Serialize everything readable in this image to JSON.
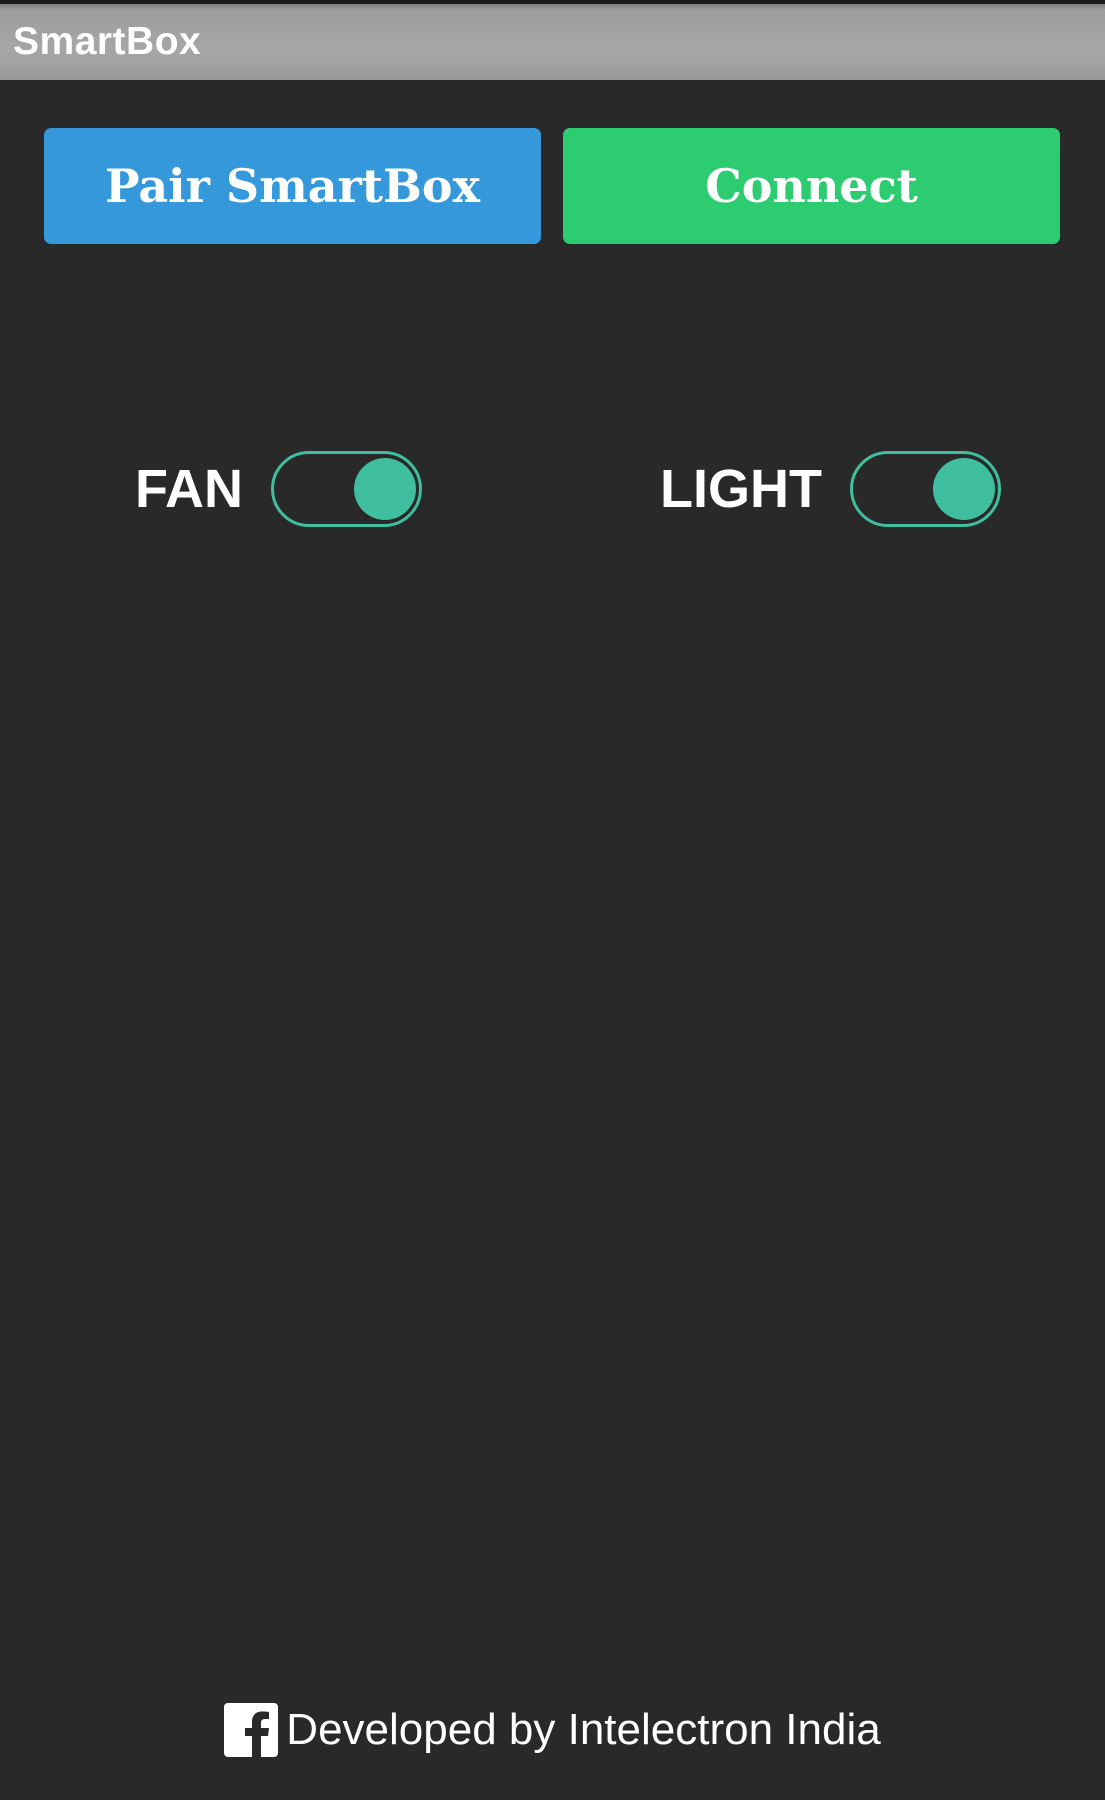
{
  "app": {
    "title": "SmartBox"
  },
  "buttons": {
    "pair_label": "Pair SmartBox",
    "connect_label": "Connect"
  },
  "toggles": [
    {
      "label": "FAN",
      "state": "on"
    },
    {
      "label": "LIGHT",
      "state": "on"
    }
  ],
  "footer": {
    "icon": "facebook-icon",
    "text": "Developed by Intelectron India"
  },
  "colors": {
    "pair_button": "#3498db",
    "connect_button": "#2ecc71",
    "toggle_accent": "#3fbf9f",
    "background": "#292929",
    "titlebar": "#a0a0a0"
  }
}
